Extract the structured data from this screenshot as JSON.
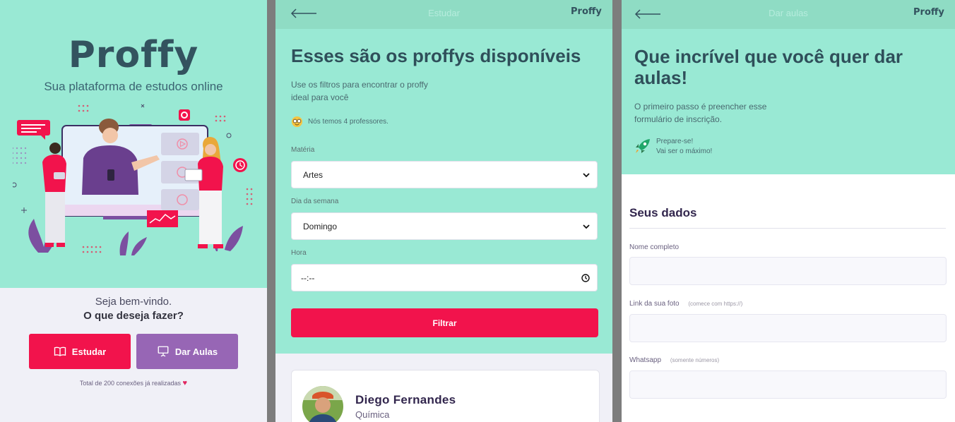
{
  "landing": {
    "logo": "Proffy",
    "tagline": "Sua plataforma de estudos online",
    "welcome": "Seja bem-vindo.",
    "question": "O que deseja fazer?",
    "study_label": "Estudar",
    "teach_label": "Dar Aulas",
    "connections": "Total de 200 conexões já realizadas",
    "colors": {
      "hero": "#99e9d4",
      "study": "#f2134c",
      "teach": "#9766b5"
    }
  },
  "study": {
    "topbar_title": "Estudar",
    "topbar_logo": "Proffy",
    "title": "Esses são os proffys disponíveis",
    "description_line1": "Use os filtros para encontrar o proffy",
    "description_line2": "ideal para você",
    "teacher_count": "Nós temos 4 professores.",
    "subject_label": "Matéria",
    "subject_value": "Artes",
    "weekday_label": "Dia da semana",
    "weekday_value": "Domingo",
    "time_label": "Hora",
    "time_value": "--:--",
    "filter_label": "Filtrar",
    "teacher": {
      "name": "Diego Fernandes",
      "subject": "Química"
    }
  },
  "teach": {
    "topbar_title": "Dar aulas",
    "topbar_logo": "Proffy",
    "title_line1": "Que incrível que você quer dar",
    "title_line2": "aulas!",
    "description_line1": "O primeiro passo é preencher esse",
    "description_line2": "formulário de inscrição.",
    "prepare_line1": "Prepare-se!",
    "prepare_line2": "Vai ser o máximo!",
    "section_title": "Seus dados",
    "name_label": "Nome completo",
    "photo_label": "Link da sua foto",
    "photo_hint": "(comece com https://)",
    "whatsapp_label": "Whatsapp",
    "whatsapp_hint": "(somente números)"
  }
}
